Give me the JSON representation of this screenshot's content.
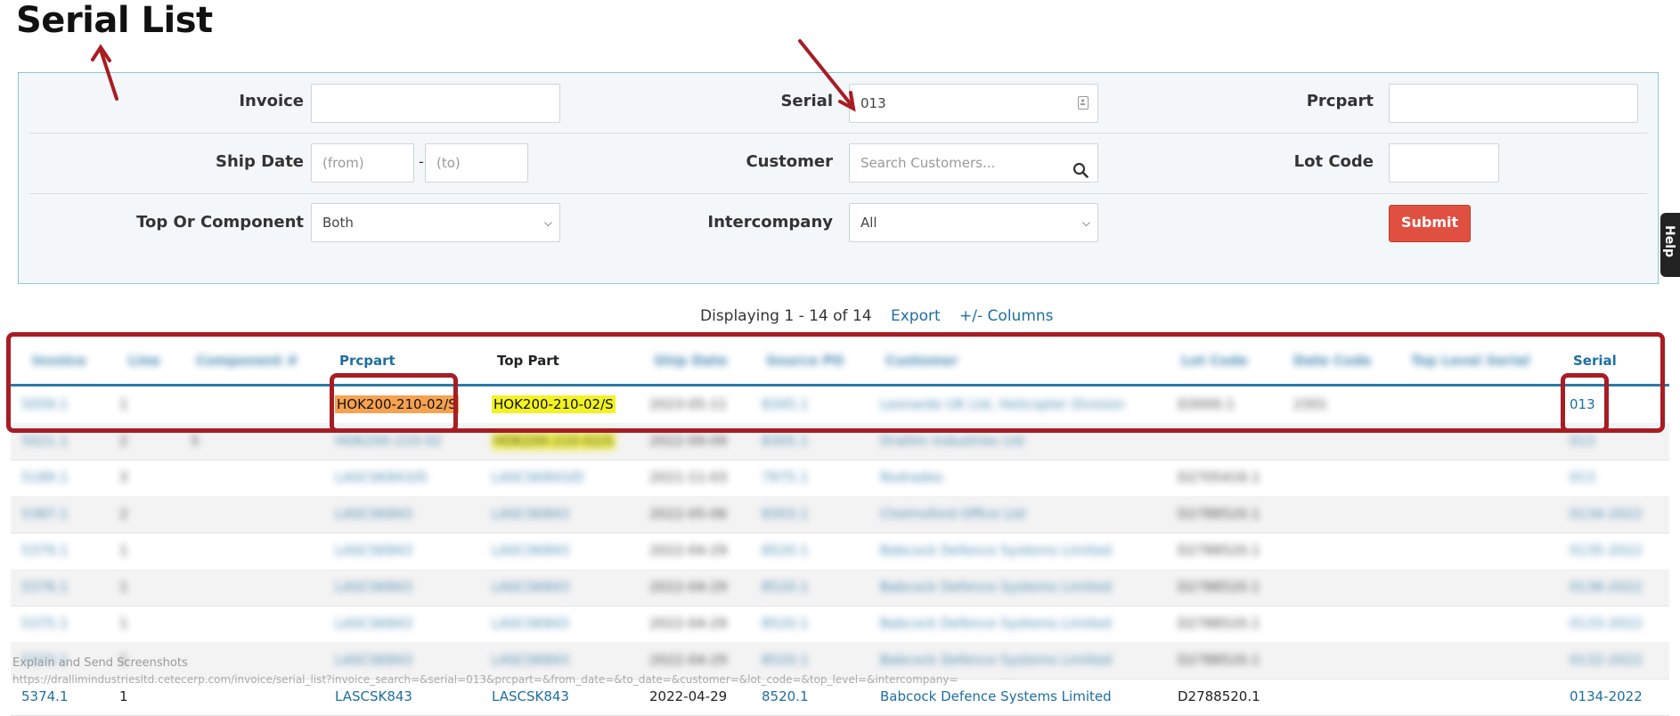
{
  "page": {
    "title": "Serial List"
  },
  "filters": {
    "invoice_label": "Invoice",
    "invoice_value": "",
    "serial_label": "Serial",
    "serial_value": "013",
    "prcpart_label": "Prcpart",
    "prcpart_value": "",
    "ship_date_label": "Ship Date",
    "ship_from_placeholder": "(from)",
    "ship_to_placeholder": "(to)",
    "ship_separator": "-",
    "customer_label": "Customer",
    "customer_placeholder": "Search Customers...",
    "lot_code_label": "Lot Code",
    "lot_code_value": "",
    "top_or_component_label": "Top Or Component",
    "top_or_component_value": "Both",
    "intercompany_label": "Intercompany",
    "intercompany_value": "All",
    "submit_label": "Submit"
  },
  "results": {
    "display_text": "Displaying 1 - 14 of 14",
    "export_label": "Export",
    "columns_label": "+/- Columns"
  },
  "table": {
    "headers": {
      "invoice": "Invoice",
      "line": "Line",
      "component": "Component #",
      "prcpart": "Prcpart",
      "top_part": "Top Part",
      "ship_date": "Ship Date",
      "source_po": "Source PO",
      "customer": "Customer",
      "lot_code": "Lot Code",
      "date_code": "Date Code",
      "top_level_serial": "Top Level Serial",
      "serial": "Serial"
    },
    "rows": [
      {
        "invoice": "5059.1",
        "line": "1",
        "component": "",
        "prcpart": "HOK200-210-02/S",
        "top_part": "HOK200-210-02/S",
        "ship_date": "2023-05-11",
        "source_po": "8345.1",
        "customer": "Leonardo UK Ltd, Helicopter Division",
        "lot_code": "D3000.1",
        "date_code": "2301",
        "top_level_serial": "",
        "serial": "013"
      },
      {
        "invoice": "5021.1",
        "line": "2",
        "component": "5",
        "prcpart": "HOK200-210-02",
        "top_part": "HOK200-210-02/S",
        "ship_date": "2022-09-09",
        "source_po": "8305.1",
        "customer": "Drallim Industries Ltd",
        "lot_code": "",
        "date_code": "",
        "top_level_serial": "",
        "serial": "013"
      },
      {
        "invoice": "5189.1",
        "line": "3",
        "component": "",
        "prcpart": "LASCSK843/D",
        "top_part": "LASCSK843/D",
        "ship_date": "2021-11-03",
        "source_po": "7975.1",
        "customer": "Rodrades",
        "lot_code": "D2705416.1",
        "date_code": "",
        "top_level_serial": "",
        "serial": "013"
      },
      {
        "invoice": "5387.1",
        "line": "2",
        "component": "",
        "prcpart": "LASCSK843",
        "top_part": "LASCSK843",
        "ship_date": "2022-05-06",
        "source_po": "8303.1",
        "customer": "Chelmsford Office Ltd",
        "lot_code": "D2788520.1",
        "date_code": "",
        "top_level_serial": "",
        "serial": "0134-2022"
      },
      {
        "invoice": "5379.1",
        "line": "1",
        "component": "",
        "prcpart": "LASCSK843",
        "top_part": "LASCSK843",
        "ship_date": "2022-04-29",
        "source_po": "8520.1",
        "customer": "Babcock Defence Systems Limited",
        "lot_code": "D2788520.1",
        "date_code": "",
        "top_level_serial": "",
        "serial": "0135-2022"
      },
      {
        "invoice": "5376.1",
        "line": "1",
        "component": "",
        "prcpart": "LASCSK843",
        "top_part": "LASCSK843",
        "ship_date": "2022-04-29",
        "source_po": "8520.1",
        "customer": "Babcock Defence Systems Limited",
        "lot_code": "D2788520.1",
        "date_code": "",
        "top_level_serial": "",
        "serial": "0136-2022"
      },
      {
        "invoice": "5375.1",
        "line": "1",
        "component": "",
        "prcpart": "LASCSK843",
        "top_part": "LASCSK843",
        "ship_date": "2022-04-29",
        "source_po": "8520.1",
        "customer": "Babcock Defence Systems Limited",
        "lot_code": "D2788520.1",
        "date_code": "",
        "top_level_serial": "",
        "serial": "0133-2022"
      },
      {
        "invoice": "5373.1",
        "line": "1",
        "component": "",
        "prcpart": "LASCSK843",
        "top_part": "LASCSK843",
        "ship_date": "2022-04-29",
        "source_po": "8520.1",
        "customer": "Babcock Defence Systems Limited",
        "lot_code": "D2788520.1",
        "date_code": "",
        "top_level_serial": "",
        "serial": "0132-2022"
      },
      {
        "invoice": "5374.1",
        "line": "1",
        "component": "",
        "prcpart": "LASCSK843",
        "top_part": "LASCSK843",
        "ship_date": "2022-04-29",
        "source_po": "8520.1",
        "customer": "Babcock Defence Systems Limited",
        "lot_code": "D2788520.1",
        "date_code": "",
        "top_level_serial": "",
        "serial": "0134-2022"
      }
    ]
  },
  "overlay": {
    "explain_text": "Explain and Send Screenshots",
    "url_text": "https://drallimindustriesltd.cetecerp.com/invoice/serial_list?invoice_search=&serial=013&prcpart=&from_date=&to_date=&customer=&lot_code=&top_level=&intercompany="
  },
  "help_tab": {
    "label": "Help"
  },
  "icons": {
    "customer_search": "search-icon",
    "serial_field": "contact-card-icon"
  },
  "colors": {
    "link": "#1f6fa0",
    "submit": "#e05040",
    "annotation": "#a81c24",
    "highlight_prcpart": "#f6a250",
    "highlight_toppart": "#f3f324"
  }
}
